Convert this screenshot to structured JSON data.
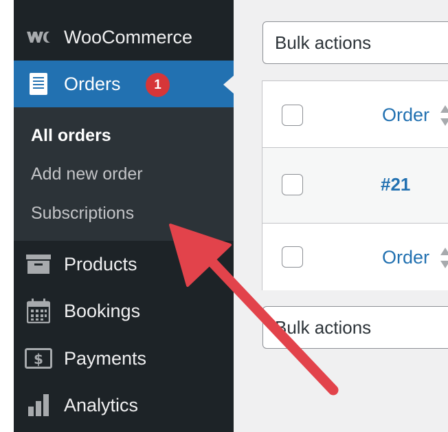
{
  "sidebar": {
    "woocommerce": {
      "label": "WooCommerce",
      "icon": "woocommerce-logo-icon"
    },
    "orders": {
      "label": "Orders",
      "badge": "1",
      "icon": "orders-document-icon"
    },
    "submenu": [
      {
        "label": "All orders",
        "current": true
      },
      {
        "label": "Add new order",
        "current": false
      },
      {
        "label": "Subscriptions",
        "current": false
      }
    ],
    "products": {
      "label": "Products",
      "icon": "archive-box-icon"
    },
    "bookings": {
      "label": "Bookings",
      "icon": "calendar-icon"
    },
    "payments": {
      "label": "Payments",
      "icon": "dollar-icon"
    },
    "analytics": {
      "label": "Analytics",
      "icon": "bar-chart-icon"
    }
  },
  "main": {
    "bulk_actions_top": "Bulk actions",
    "bulk_actions_bottom": "Bulk actions",
    "table": {
      "header_order": "Order",
      "row_order": "#21",
      "footer_order": "Order"
    }
  },
  "colors": {
    "sidebar_bg": "#1d2327",
    "submenu_bg": "#2c3338",
    "accent": "#2271b1",
    "badge": "#d63638",
    "annotation_arrow": "#e2434b"
  }
}
